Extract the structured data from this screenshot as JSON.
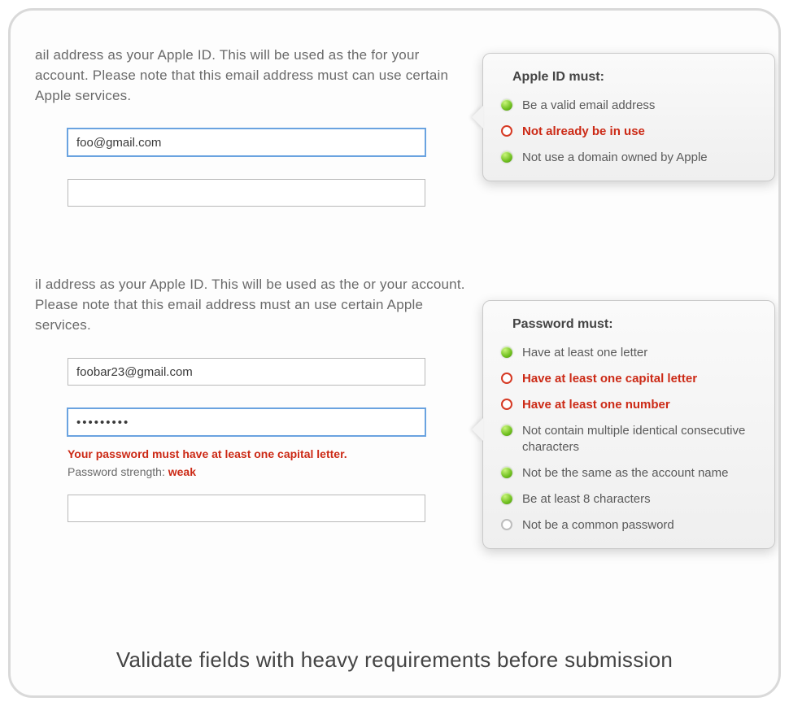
{
  "section1": {
    "blurb": "ail address as your Apple ID. This will be used as the for your account. Please note that this email address must can use certain Apple services.",
    "input1_value": "foo@gmail.com",
    "input2_value": ""
  },
  "popover1": {
    "title": "Apple ID must:",
    "items": [
      {
        "status": "ok",
        "text": "Be a valid email address"
      },
      {
        "status": "bad",
        "text": "Not already be in use"
      },
      {
        "status": "ok",
        "text": "Not use a domain owned by Apple"
      }
    ]
  },
  "section2": {
    "blurb": "il address as your Apple ID. This will be used as the or your account. Please note that this email address must an use certain Apple services.",
    "input1_value": "foobar23@gmail.com",
    "pwd_value": "•••••••••",
    "error": "Your password must have at least one capital letter.",
    "strength_label": "Password strength: ",
    "strength_value": "weak",
    "input3_value": ""
  },
  "popover2": {
    "title": "Password must:",
    "items": [
      {
        "status": "ok",
        "text": "Have at least one letter"
      },
      {
        "status": "bad",
        "text": "Have at least one capital letter"
      },
      {
        "status": "bad",
        "text": "Have at least one number"
      },
      {
        "status": "ok",
        "text": "Not contain multiple identical consecutive characters"
      },
      {
        "status": "ok",
        "text": "Not be the same as the account name"
      },
      {
        "status": "ok",
        "text": "Be at least 8 characters"
      },
      {
        "status": "neutral",
        "text": "Not be a common password"
      }
    ]
  },
  "caption": "Validate fields with heavy requirements before submission"
}
